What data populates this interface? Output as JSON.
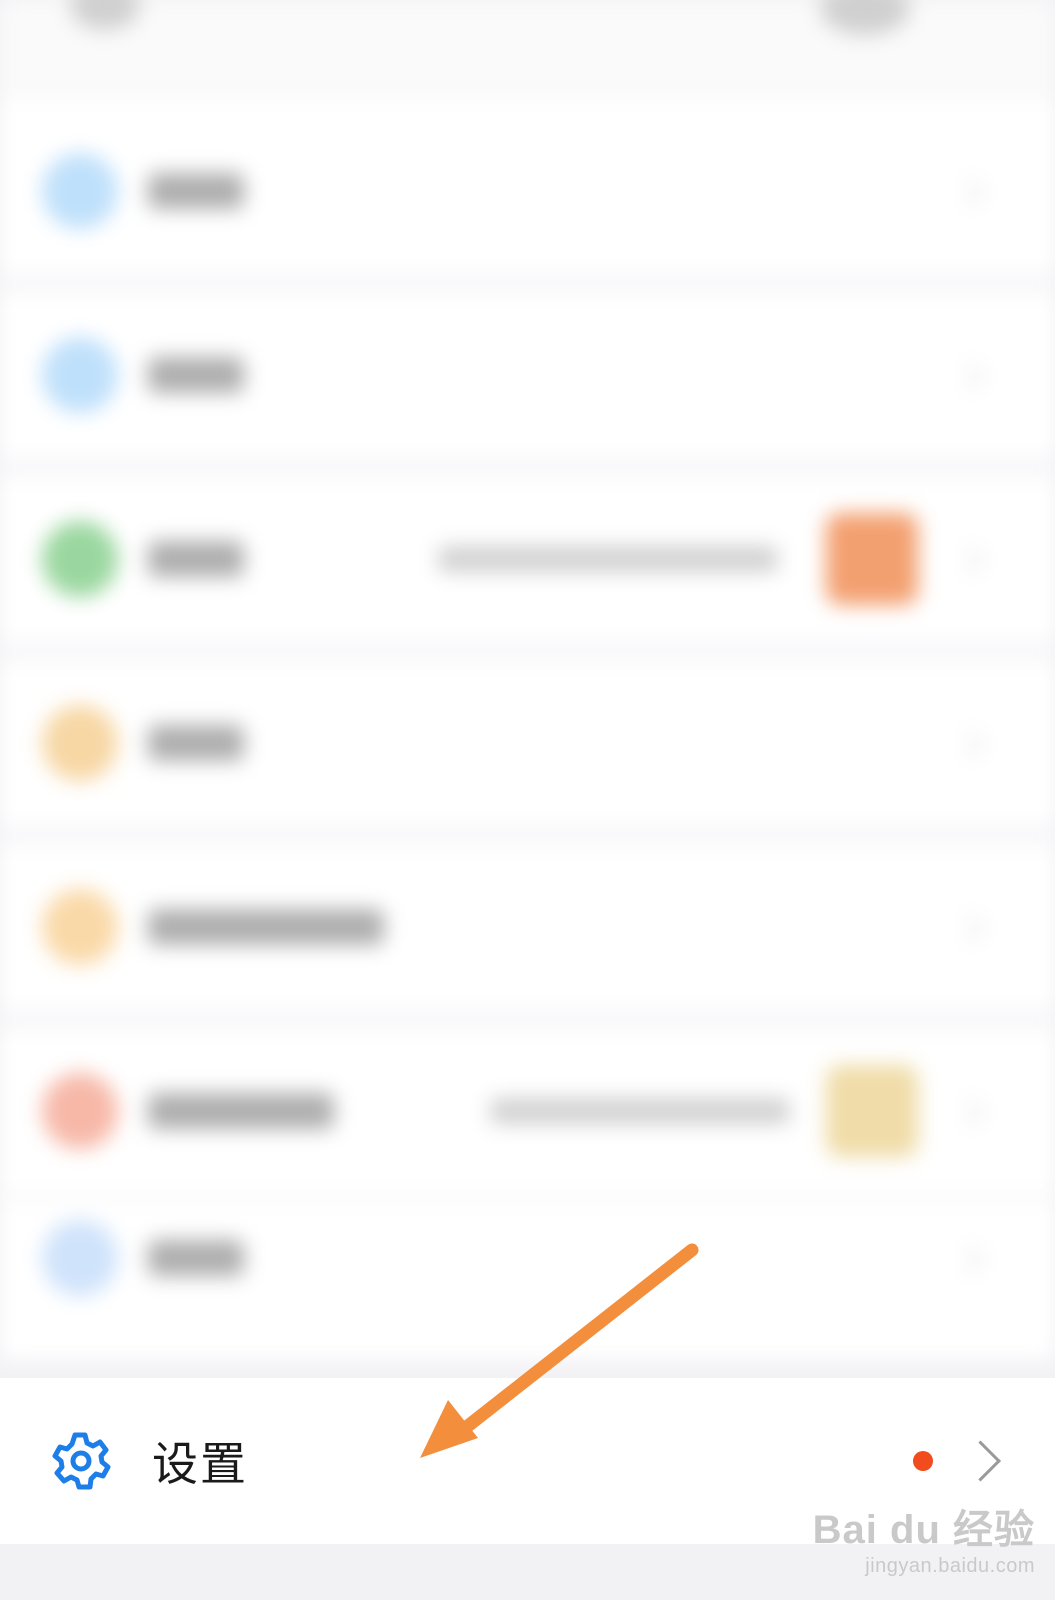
{
  "colors": {
    "accent_blue": "#1e7ee8",
    "badge_red": "#f24c1e",
    "annotation_orange": "#f28e3c"
  },
  "settings_row": {
    "label": "设置",
    "icon": "gear-icon",
    "chevron_icon": "chevron-right-icon",
    "has_badge": true
  },
  "blurred_items": [
    {
      "icon_color": "#bfe0fb"
    },
    {
      "icon_color": "#bfe0fb"
    },
    {
      "icon_color": "#9ad79f",
      "thumb_color": "#f3a070"
    },
    {
      "icon_color": "#f7d7a4"
    },
    {
      "icon_color": "#fad9a8"
    },
    {
      "icon_color": "#f7b8a8",
      "thumb_color": "#f0dca8"
    },
    {
      "icon_color": "#cfe3fb"
    }
  ],
  "watermark": {
    "logo_text": "Bai du 经验",
    "url": "jingyan.baidu.com"
  }
}
